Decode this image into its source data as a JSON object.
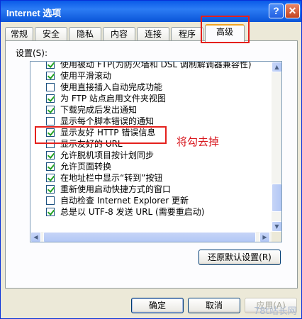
{
  "window": {
    "title": "Internet 选项",
    "help_label": "?",
    "close_label": "✕"
  },
  "tabs": [
    {
      "label": "常规"
    },
    {
      "label": "安全"
    },
    {
      "label": "隐私"
    },
    {
      "label": "内容"
    },
    {
      "label": "连接"
    },
    {
      "label": "程序"
    },
    {
      "label": "高级",
      "active": true
    }
  ],
  "settings": {
    "label": "设置(S):",
    "items": [
      {
        "label": "使用被动 FTP(为防火墙和 DSL 调制解调器兼容性)",
        "checked": true
      },
      {
        "label": "使用平滑滚动",
        "checked": true
      },
      {
        "label": "使用直接插入自动完成功能",
        "checked": false
      },
      {
        "label": "为 FTP 站点启用文件夹视图",
        "checked": true
      },
      {
        "label": "下载完成后发出通知",
        "checked": true
      },
      {
        "label": "显示每个脚本错误的通知",
        "checked": false
      },
      {
        "label": "显示友好 HTTP 错误信息",
        "checked": true
      },
      {
        "label": "显示友好的 URL",
        "checked": false
      },
      {
        "label": "允许脱机项目按计划同步",
        "checked": true
      },
      {
        "label": "允许页面转换",
        "checked": true
      },
      {
        "label": "在地址栏中显示“转到”按钮",
        "checked": true
      },
      {
        "label": "重新使用启动快捷方式的窗口",
        "checked": true
      },
      {
        "label": "自动检查 Internet Explorer 更新",
        "checked": false
      },
      {
        "label": "总是以 UTF-8 发送 URL (需要重启动)",
        "checked": true
      }
    ]
  },
  "restore_button": "还原默认设置(R)",
  "footer": {
    "ok": "确定",
    "cancel": "取消",
    "apply": "应用(A)"
  },
  "annotation": "将勾去掉",
  "watermark": "78t站长网",
  "colors": {
    "accent_red": "#e4201c",
    "title_blue": "#0a5ae8",
    "check_green": "#21a121"
  }
}
